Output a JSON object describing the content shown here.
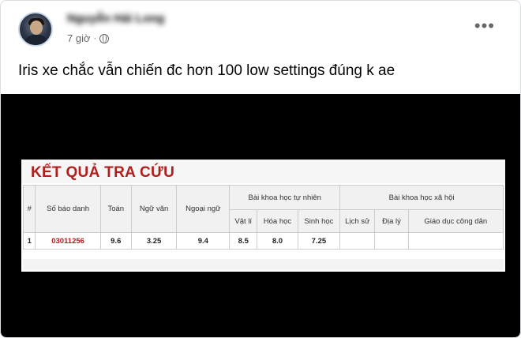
{
  "post": {
    "author_name": "Nguyễn Hải Long",
    "time": "7 giờ",
    "caption": "Iris xe chắc vẫn chiến đc hơn 100 low settings đúng k ae"
  },
  "icons": {
    "more": "more-horizontal-icon",
    "audience": "globe-icon"
  },
  "result": {
    "title": "KẾT QUẢ TRA CỨU",
    "headers": {
      "index": "#",
      "candidate_no": "Số báo danh",
      "math": "Toán",
      "literature": "Ngữ văn",
      "foreign_language": "Ngoại ngữ",
      "natural_sciences": "Bài khoa học tự nhiên",
      "physics": "Vật lí",
      "chemistry": "Hóa học",
      "biology": "Sinh học",
      "social_sciences": "Bài khoa học xã hội",
      "history": "Lịch sử",
      "geography": "Địa lý",
      "civic_education": "Giáo dục công dân"
    },
    "rows": [
      {
        "index": "1",
        "candidate_no": "03011256",
        "math": "9.6",
        "literature": "3.25",
        "foreign_language": "9.4",
        "physics": "8.5",
        "chemistry": "8.0",
        "biology": "7.25",
        "history": "",
        "geography": "",
        "civic_education": ""
      }
    ]
  },
  "colors": {
    "title_red": "#b01e1e",
    "secondary_text": "#65676b",
    "media_background": "#000000"
  }
}
